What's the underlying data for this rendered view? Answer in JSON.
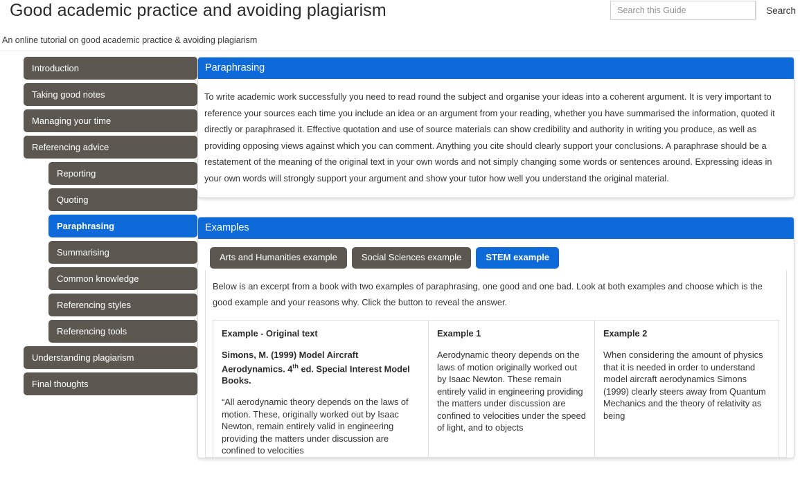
{
  "header": {
    "title": "Good academic practice and avoiding plagiarism",
    "subtitle": "An online tutorial on good academic practice & avoiding plagiarism",
    "search_placeholder": "Search this Guide",
    "search_value": "",
    "search_button": "Search"
  },
  "sidebar": {
    "items": [
      {
        "label": "Introduction",
        "sub": false,
        "active": false
      },
      {
        "label": "Taking good notes",
        "sub": false,
        "active": false
      },
      {
        "label": "Managing your time",
        "sub": false,
        "active": false
      },
      {
        "label": "Referencing advice",
        "sub": false,
        "active": false
      },
      {
        "label": "Reporting",
        "sub": true,
        "active": false
      },
      {
        "label": "Quoting",
        "sub": true,
        "active": false
      },
      {
        "label": "Paraphrasing",
        "sub": true,
        "active": true
      },
      {
        "label": "Summarising",
        "sub": true,
        "active": false
      },
      {
        "label": "Common knowledge",
        "sub": true,
        "active": false
      },
      {
        "label": "Referencing styles",
        "sub": true,
        "active": false
      },
      {
        "label": "Referencing tools",
        "sub": true,
        "active": false
      },
      {
        "label": "Understanding plagiarism",
        "sub": false,
        "active": false
      },
      {
        "label": "Final thoughts",
        "sub": false,
        "active": false
      }
    ]
  },
  "paraphrasing_card": {
    "heading": "Paraphrasing",
    "body": "To write academic work successfully you need to read round the subject and organise your ideas into a coherent argument. It is very important to reference your sources each time you include an idea or an argument from your reading, whether you have summarised the information, quoted it directly or paraphrased it. Effective quotation and use of source materials can show credibility and authority in writing you produce, as well as providing opposing views against which you can comment. Anything you cite should clearly support your conclusions. A paraphrase should be a restatement of the meaning of the original text in your own words and not simply changing some words or sentences around. Expressing ideas in your own words will strongly support your argument and show your tutor how well you understand the original material."
  },
  "examples_card": {
    "heading": "Examples",
    "tabs": [
      {
        "label": "Arts and Humanities example",
        "active": false
      },
      {
        "label": "Social Sciences example",
        "active": false
      },
      {
        "label": "STEM example",
        "active": true
      }
    ],
    "intro": "Below is an excerpt from a book with two examples of paraphrasing, one good and one bad. Look at both examples and choose which is the good example and your reasons why. Click the button to reveal the answer.",
    "columns": {
      "original": {
        "title": "Example - Original text",
        "citation_part1": "Simons, M. (1999) Model Aircraft Aerodynamics. 4",
        "citation_sup": "th",
        "citation_part2": " ed. Special Interest Model Books.",
        "text": "“All aerodynamic theory depends on the laws of motion. These, originally worked out by Isaac Newton, remain entirely valid in engineering providing the matters under discussion are confined to velocities"
      },
      "example1": {
        "title": "Example 1",
        "text": "Aerodynamic theory depends on the laws of motion originally worked out by Isaac Newton. These remain entirely valid in engineering providing the matters under discussion are confined to velocities under the speed of light, and to objects"
      },
      "example2": {
        "title": "Example 2",
        "text": "When considering the amount of physics that it is needed in order to understand model aircraft aerodynamics Simons (1999) clearly steers away from Quantum Mechanics and the theory of relativity as being"
      }
    }
  }
}
